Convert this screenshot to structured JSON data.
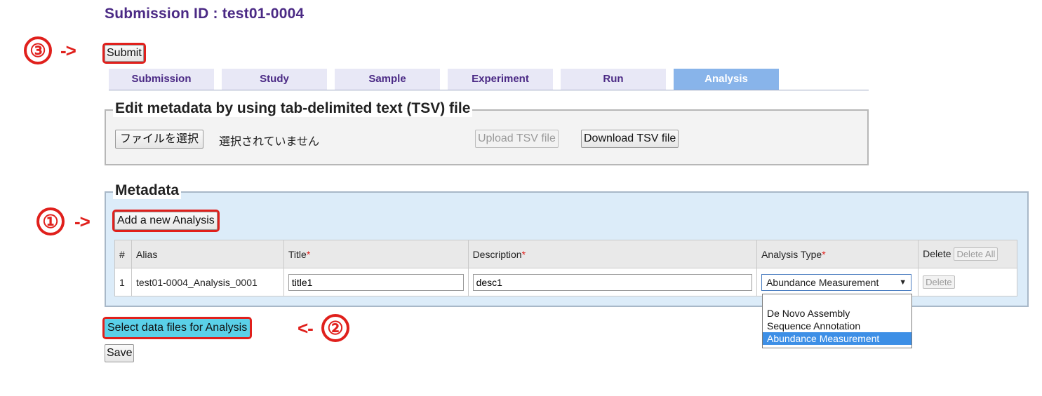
{
  "header": {
    "title": "Submission ID : test01-0004"
  },
  "annotations": {
    "marker3": {
      "num": "③",
      "arrow": "->"
    },
    "marker1": {
      "num": "①",
      "arrow": "->"
    },
    "marker2": {
      "num": "②",
      "arrow": "<-"
    }
  },
  "submit_label": "Submit",
  "tabs": [
    {
      "label": "Submission",
      "active": false
    },
    {
      "label": "Study",
      "active": false
    },
    {
      "label": "Sample",
      "active": false
    },
    {
      "label": "Experiment",
      "active": false
    },
    {
      "label": "Run",
      "active": false
    },
    {
      "label": "Analysis",
      "active": true
    }
  ],
  "tsv_section": {
    "legend": "Edit metadata by using tab-delimited text (TSV) file",
    "choose_file_label": "ファイルを選択",
    "no_file_text": "選択されていません",
    "upload_label": "Upload TSV file",
    "download_label": "Download TSV file"
  },
  "metadata_section": {
    "legend": "Metadata",
    "add_label": "Add a new Analysis",
    "columns": {
      "num": "#",
      "alias": "Alias",
      "title": "Title",
      "description": "Description",
      "analysis_type": "Analysis Type",
      "delete": "Delete",
      "required_mark": "*"
    },
    "delete_all_label": "Delete All",
    "rows": [
      {
        "num": "1",
        "alias": "test01-0004_Analysis_0001",
        "title": "title1",
        "description": "desc1",
        "analysis_type": "Abundance Measurement",
        "delete_label": "Delete"
      }
    ]
  },
  "dropdown": {
    "options": [
      "",
      "De Novo Assembly",
      "Sequence Annotation",
      "Abundance Measurement"
    ],
    "selected": "Abundance Measurement",
    "caret_icon": "▼"
  },
  "select_files_label": "Select data files for Analysis",
  "save_label": "Save",
  "colors": {
    "accent": "#4b2a85",
    "annotation": "#e0201c",
    "active_tab": "#88b4ea",
    "highlight": "#5ad0e8"
  }
}
